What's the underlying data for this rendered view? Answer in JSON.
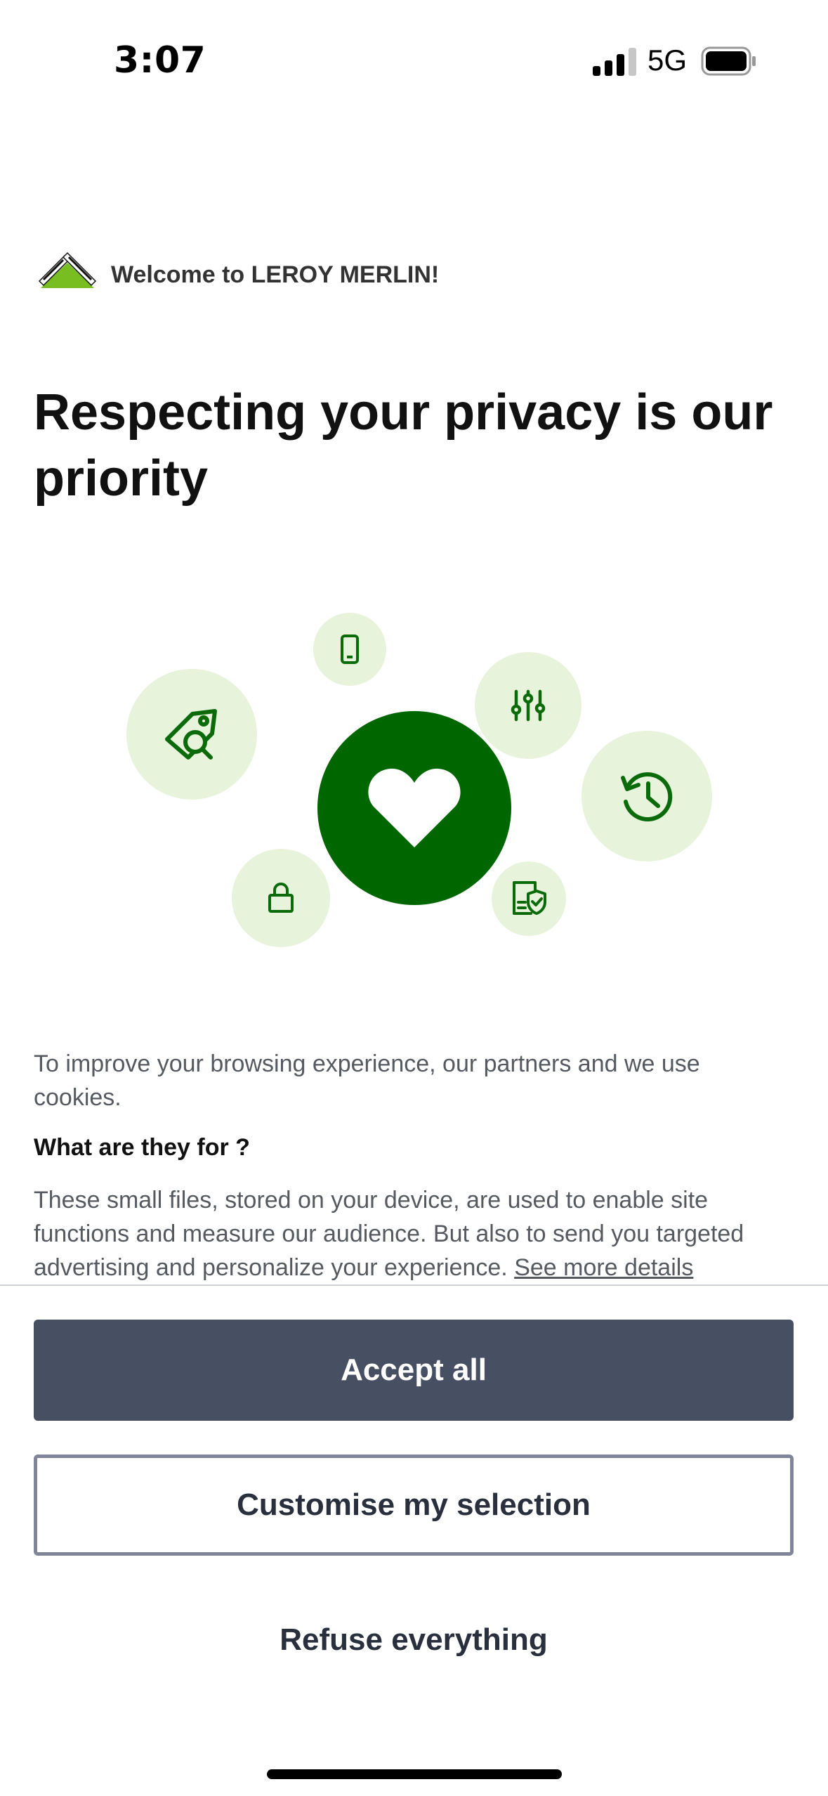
{
  "status_bar": {
    "time": "3:07",
    "network": "5G",
    "icons": [
      "cellular-signal-icon",
      "battery-icon"
    ]
  },
  "header": {
    "logo": "leroy-merlin-logo",
    "welcome_text": "Welcome to LEROY MERLIN!"
  },
  "title": "Respecting your privacy is our priority",
  "illustration": {
    "icons": [
      "heart-icon",
      "tag-search-icon",
      "phone-icon",
      "sliders-icon",
      "history-icon",
      "lock-icon",
      "shield-document-icon"
    ],
    "colors": {
      "primary": "#006600",
      "bubble": "#e8f3dc"
    }
  },
  "content": {
    "intro": "To improve your browsing experience, our partners and we use cookies.",
    "subheading": "What are they for ?",
    "details": "These small files, stored on your device, are used to enable site functions and measure our audience. But also to send you targeted advertising and personalize your experience. ",
    "details_link": "See more details"
  },
  "actions": {
    "accept_all": "Accept all",
    "customise": "Customise my selection",
    "refuse": "Refuse everything"
  },
  "colors": {
    "accept_button": "#474f63",
    "button_text_dark": "#2a2f3d",
    "brand_green": "#006600"
  }
}
